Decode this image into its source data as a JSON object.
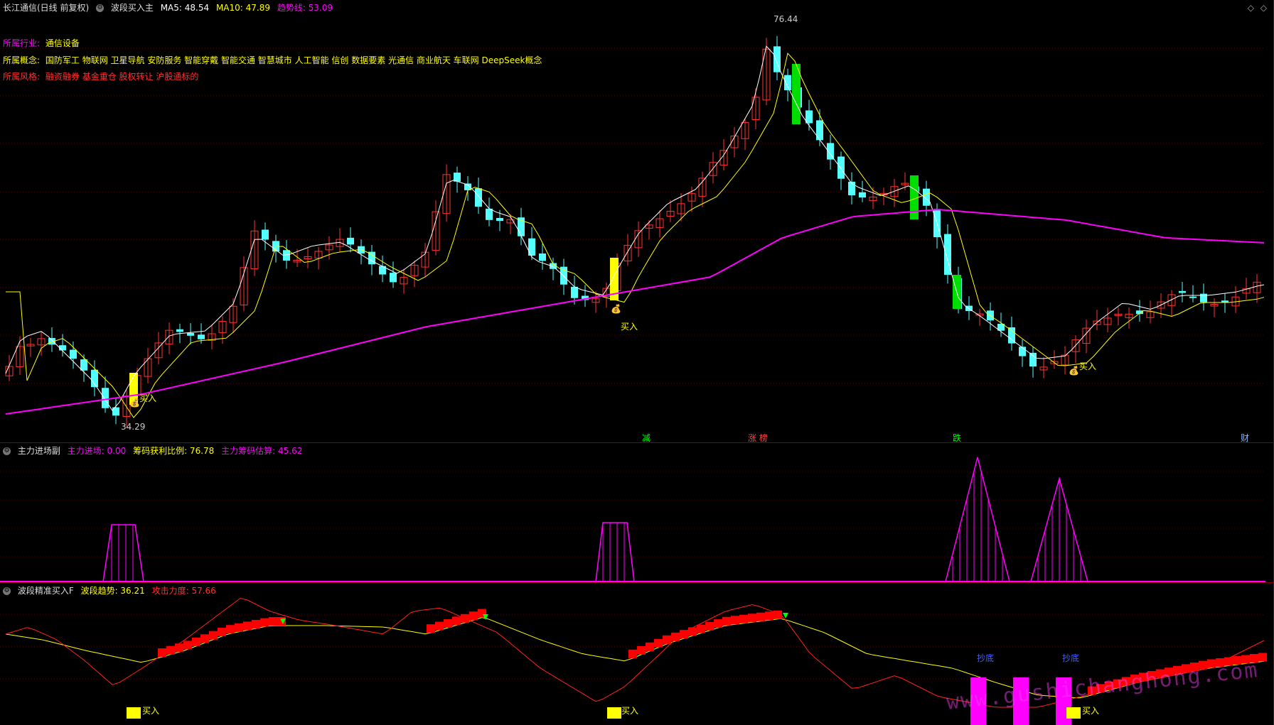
{
  "main_panel": {
    "title": "长江通信(日线 前复权)",
    "indicator_name": "波段买入主",
    "ma5_label": "MA5: 48.54",
    "ma10_label": "MA10: 47.89",
    "trend_label": "趋势线: 53.09",
    "industry_label": "所属行业:",
    "industry_value": "通信设备",
    "concept_label": "所属概念:",
    "concept_value": "国防军工 物联网 卫星导航 安防服务 智能穿戴 智能交通 智慧城市 人工智能 信创 数据要素 光通信 商业航天 车联网 DeepSeek概念",
    "style_label": "所属风格:",
    "style_value": "融资融券 基金重仓 股权转让 沪股通标的",
    "high_price": "76.44",
    "low_price": "34.29",
    "buy_label": "买入",
    "event_markers": [
      "减",
      "涨 榜",
      "跌",
      "财"
    ]
  },
  "sub_panel_1": {
    "indicator_name": "主力进场副",
    "main_entry_label": "主力进场: 0.00",
    "chip_profit_label": "筹码获利比例: 76.78",
    "main_chip_label": "主力筹码估算: 45.62"
  },
  "sub_panel_2": {
    "indicator_name": "波段精准买入F",
    "trend_label": "波段趋势: 36.21",
    "attack_label": "攻击力度: 57.66",
    "buy_label": "买入",
    "top_label": "抄底",
    "watermark": "www.gushichanghong.com"
  },
  "colors": {
    "up": "#ff3232",
    "down": "#54ffff",
    "ma5": "#ffffff",
    "ma10": "#ffff00",
    "trend": "#ff00ff",
    "buy_bar": "#ffff00",
    "signal_green": "#00dd00"
  },
  "icons": [
    "settings-circle-icon",
    "diamond-icon",
    "money-bag-icon",
    "down-arrow-icon"
  ]
}
